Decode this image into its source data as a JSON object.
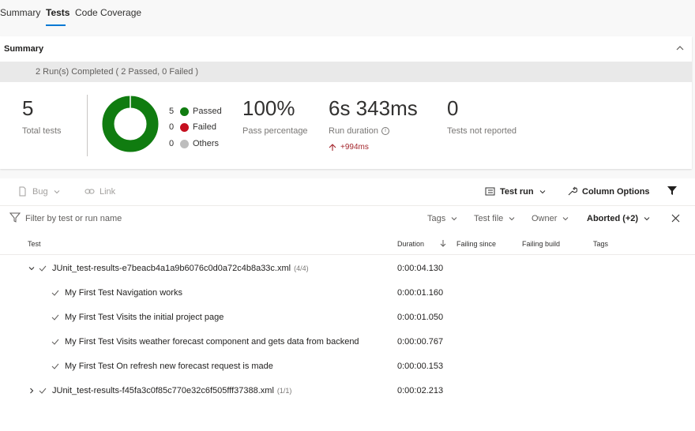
{
  "tabs": [
    {
      "label": "Summary",
      "active": false
    },
    {
      "label": "Tests",
      "active": true
    },
    {
      "label": "Code Coverage",
      "active": false
    }
  ],
  "summary": {
    "title": "Summary",
    "runs_text": "2 Run(s) Completed ( 2 Passed, 0 Failed )",
    "total": {
      "value": "5",
      "label": "Total tests"
    },
    "legend": [
      {
        "count": "5",
        "label": "Passed",
        "color": "#107c10"
      },
      {
        "count": "0",
        "label": "Failed",
        "color": "#c50f1f"
      },
      {
        "count": "0",
        "label": "Others",
        "color": "#bdbdbd"
      }
    ],
    "pass_pct": {
      "value": "100%",
      "label": "Pass percentage"
    },
    "duration": {
      "value": "6s 343ms",
      "label": "Run duration",
      "trend": "+994ms"
    },
    "not_reported": {
      "value": "0",
      "label": "Tests not reported"
    }
  },
  "toolbar": {
    "bug": "Bug",
    "link": "Link",
    "test_run": "Test run",
    "column_options": "Column Options"
  },
  "filters": {
    "placeholder": "Filter by test or run name",
    "tags": "Tags",
    "test_file": "Test file",
    "owner": "Owner",
    "outcome": "Aborted (+2)"
  },
  "columns": {
    "test": "Test",
    "duration": "Duration",
    "failing_since": "Failing since",
    "failing_build": "Failing build",
    "tags": "Tags"
  },
  "rows": [
    {
      "name": "JUnit_test-results-e7beacb4a1a9b6076c0d0a72c4b8a33c.xml",
      "count": "(4/4)",
      "duration": "0:00:04.130",
      "level": 0,
      "expanded": true
    },
    {
      "name": "My First Test Navigation works",
      "count": "",
      "duration": "0:00:01.160",
      "level": 1
    },
    {
      "name": "My First Test Visits the initial project page",
      "count": "",
      "duration": "0:00:01.050",
      "level": 1
    },
    {
      "name": "My First Test Visits weather forecast component and gets data from backend",
      "count": "",
      "duration": "0:00:00.767",
      "level": 1
    },
    {
      "name": "My First Test On refresh new forecast request is made",
      "count": "",
      "duration": "0:00:00.153",
      "level": 1
    },
    {
      "name": "JUnit_test-results-f45fa3c0f85c770e32c6f505fff37388.xml",
      "count": "(1/1)",
      "duration": "0:00:02.213",
      "level": 0,
      "expanded": false
    }
  ],
  "colors": {
    "accent": "#0078d4",
    "pass": "#107c10",
    "fail": "#c50f1f",
    "trend": "#a4262c"
  },
  "icons": {
    "collapse": "chevron-up-icon",
    "bug": "bug-icon",
    "link": "link-icon",
    "test_run": "list-icon",
    "column_options": "wrench-icon",
    "filter": "funnel-icon",
    "close": "close-icon",
    "check": "check-icon"
  }
}
